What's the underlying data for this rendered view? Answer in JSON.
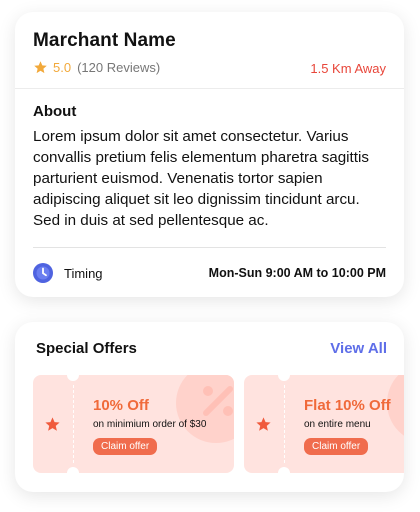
{
  "merchant": {
    "name": "Marchant Name",
    "rating": "5.0",
    "reviews": "(120 Reviews)",
    "distance": "1.5 Km Away",
    "about_title": "About",
    "about_text": "Lorem ipsum dolor sit amet consectetur. Varius convallis pretium felis elementum pharetra sagittis parturient euismod. Venenatis tortor sapien adipiscing aliquet sit leo dignissim tincidunt arcu. Sed in duis at sed pellentesque ac.",
    "timing_label": "Timing",
    "timing_value": "Mon-Sun 9:00 AM to 10:00 PM"
  },
  "offers": {
    "title": "Special Offers",
    "view_all": "View All",
    "items": [
      {
        "title": "10% Off",
        "desc": "on minimium order of $30",
        "button": "Claim offer"
      },
      {
        "title": "Flat 10% Off",
        "desc": "on entire menu",
        "button": "Claim offer"
      }
    ]
  },
  "colors": {
    "accent_red": "#e8463a",
    "rating_gold": "#f2a93b",
    "link_blue": "#5e6ee8",
    "offer_bg": "#ffe3df",
    "offer_orange": "#f06a3a"
  },
  "icons": {
    "rating": "star-icon",
    "timing": "clock-icon",
    "offer": "star-icon",
    "offer_bg": "percent-icon"
  }
}
